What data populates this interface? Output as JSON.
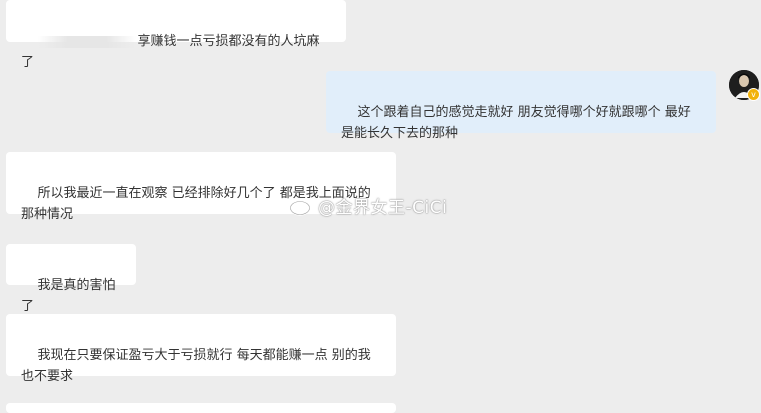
{
  "messages": [
    {
      "side": "incoming",
      "text": "享赚钱一点亏损都没有的人坑麻了",
      "partially_obscured": true
    },
    {
      "side": "outgoing",
      "text": "这个跟着自己的感觉走就好 朋友觉得哪个好就跟哪个 最好是能长久下去的那种"
    },
    {
      "side": "incoming",
      "text": "所以我最近一直在观察 已经排除好几个了 都是我上面说的那种情况"
    },
    {
      "side": "incoming",
      "text": "我是真的害怕了"
    },
    {
      "side": "incoming",
      "text": "我现在只要保证盈亏大于亏损就行 每天都能赚一点 别的我也不要求"
    }
  ],
  "avatar": {
    "icon": "user-avatar-icon",
    "badge_icon": "verified-badge-icon",
    "badge_color": "#f2b20a"
  },
  "watermark": {
    "icon": "weibo-logo-icon",
    "text": "@金界女王-CiCi"
  },
  "colors": {
    "background": "#ededed",
    "incoming_bubble": "#ffffff",
    "outgoing_bubble": "#e1eefa",
    "text": "#333333"
  }
}
